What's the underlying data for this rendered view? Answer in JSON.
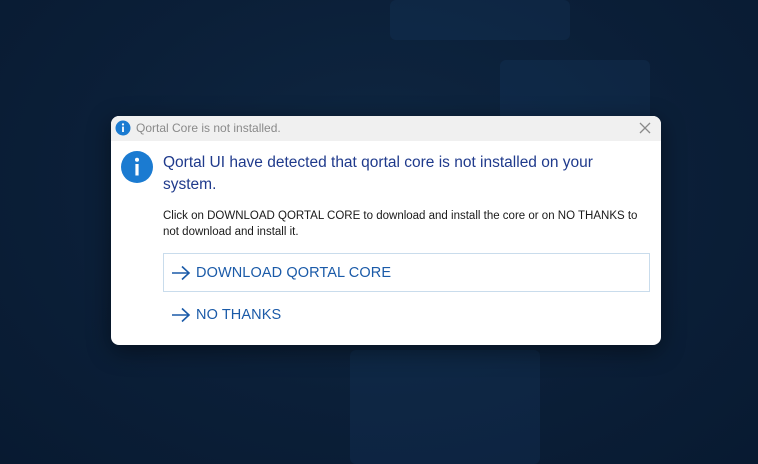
{
  "dialog": {
    "title": "Qortal Core is not installed.",
    "heading": "Qortal UI have detected that qortal core is not installed on your system.",
    "message": "Click on DOWNLOAD QORTAL CORE to download and install the core or on NO THANKS to not download and install it.",
    "commands": {
      "download_label": "DOWNLOAD QORTAL CORE",
      "no_thanks_label": "NO THANKS"
    },
    "icons": {
      "title_icon": "info-icon",
      "main_icon": "info-icon",
      "close_icon": "close-icon",
      "command_icon": "arrow-right-icon"
    },
    "colors": {
      "accent": "#1a5aa8",
      "heading": "#1f3a8c",
      "info_icon": "#1b7bd1",
      "background": "#0b1f38"
    }
  }
}
